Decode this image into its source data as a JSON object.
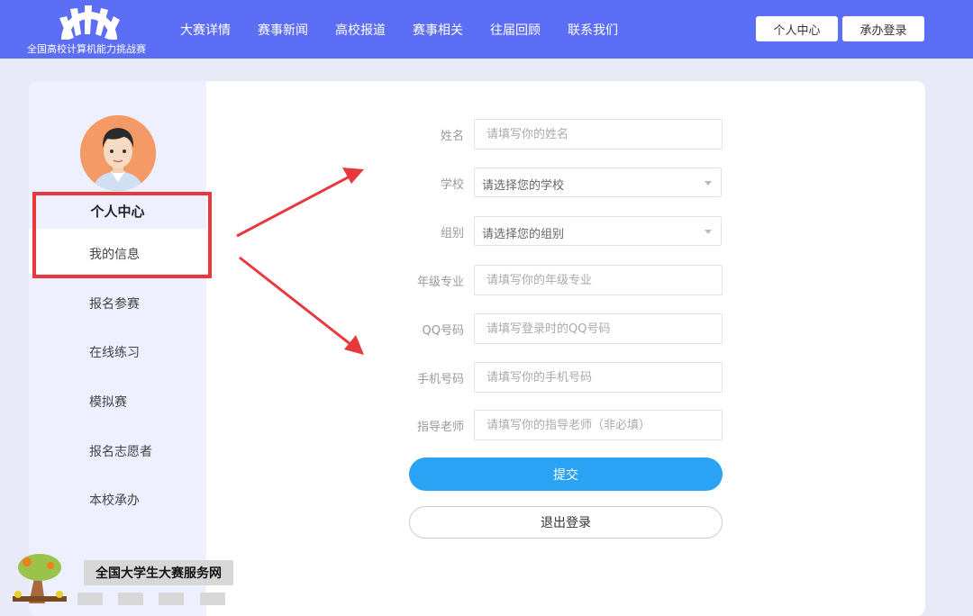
{
  "header": {
    "logo_text": "全国高校计算机能力挑战赛",
    "nav": [
      "大赛详情",
      "赛事新闻",
      "高校报道",
      "赛事相关",
      "往届回顾",
      "联系我们"
    ],
    "user_center_label": "个人中心",
    "host_login_label": "承办登录",
    "bg_color": "#5b6ef5"
  },
  "sidebar": {
    "title": "个人中心",
    "items": [
      {
        "label": "我的信息",
        "active": true
      },
      {
        "label": "报名参赛"
      },
      {
        "label": "在线练习"
      },
      {
        "label": "模拟赛"
      },
      {
        "label": "报名志愿者"
      },
      {
        "label": "本校承办"
      }
    ]
  },
  "form": {
    "fields": [
      {
        "label": "姓名",
        "placeholder": "请填写你的姓名",
        "type": "input"
      },
      {
        "label": "学校",
        "placeholder": "请选择您的学校",
        "type": "select"
      },
      {
        "label": "组别",
        "placeholder": "请选择您的组别",
        "type": "select"
      },
      {
        "label": "年级专业",
        "placeholder": "请填写你的年级专业",
        "type": "input"
      },
      {
        "label": "QQ号码",
        "placeholder": "请填写登录时的QQ号码",
        "type": "input"
      },
      {
        "label": "手机号码",
        "placeholder": "请填写你的手机号码",
        "type": "input"
      },
      {
        "label": "指导老师",
        "placeholder": "请填写你的指导老师（非必填）",
        "type": "input"
      }
    ],
    "submit_label": "提交",
    "logout_label": "退出登录",
    "submit_color": "#2ba3f5"
  },
  "watermark": {
    "text": "全国大学生大赛服务网"
  },
  "annotation_color": "#e8383d"
}
